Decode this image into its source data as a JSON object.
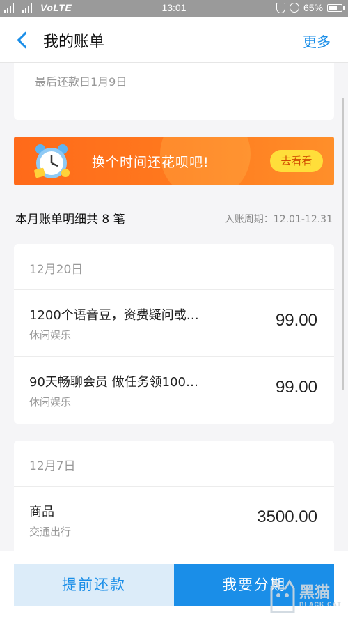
{
  "status_bar": {
    "network_small": "2G 4G",
    "carrier_tag": "VoLTE",
    "time": "13:01",
    "battery": "65%",
    "battery_level": 0.65
  },
  "nav": {
    "title": "我的账单",
    "more": "更多",
    "back_icon": "chevron-left-icon"
  },
  "last_payment": {
    "text": "最后还款日1月9日"
  },
  "banner": {
    "text": "换个时间还花呗吧!",
    "button": "去看看",
    "icon": "alarm-clock-icon"
  },
  "summary": {
    "title": "本月账单明细共 8 笔",
    "period": "入账周期：12.01-12.31"
  },
  "groups": [
    {
      "date": "12月20日",
      "items": [
        {
          "name": "1200个语音豆，资费疑问或…",
          "category": "休闲娱乐",
          "amount": "99.00"
        },
        {
          "name": "90天畅聊会员 做任务领100…",
          "category": "休闲娱乐",
          "amount": "99.00"
        }
      ]
    },
    {
      "date": "12月7日",
      "items": [
        {
          "name": "商品",
          "category": "交通出行",
          "amount": "3500.00"
        }
      ]
    }
  ],
  "bottom": {
    "prepay": "提前还款",
    "installment": "我要分期"
  },
  "watermark": {
    "cn": "黑猫",
    "en": "BLACK CAT"
  },
  "colors": {
    "accent": "#1a8ee8",
    "banner": "#ff6a1a",
    "banner_button": "#ffde3a"
  }
}
